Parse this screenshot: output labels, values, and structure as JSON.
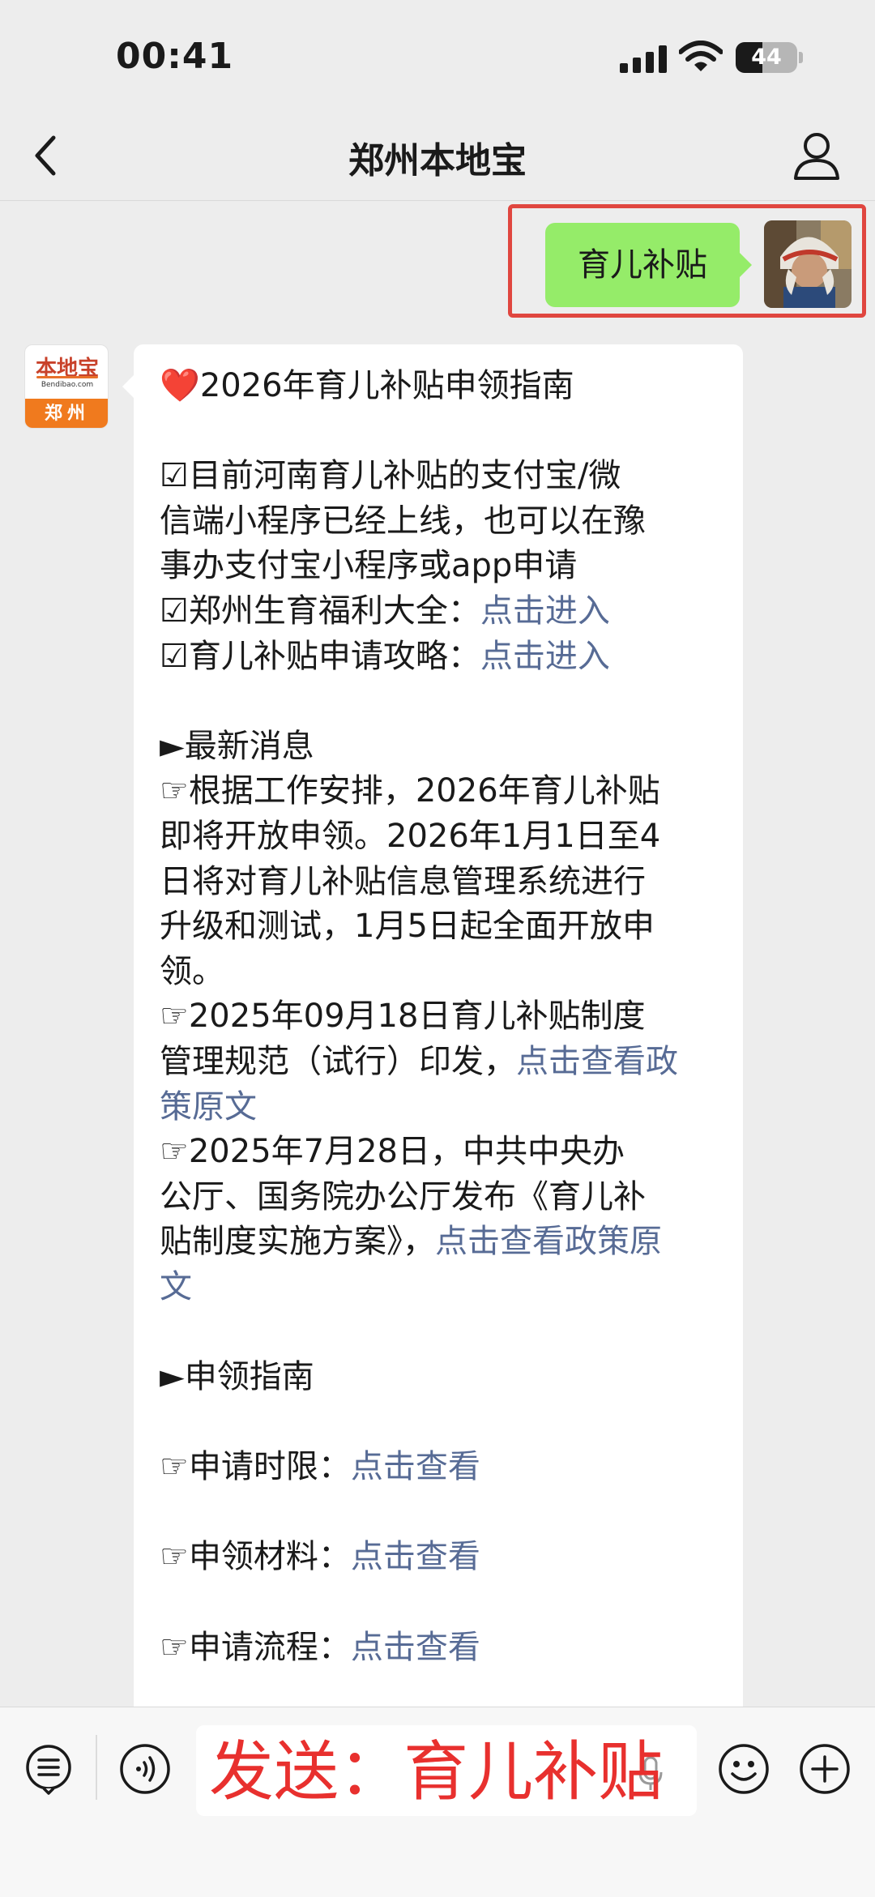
{
  "status_bar": {
    "time": "00:41",
    "battery": "44",
    "battery_level": 0.44
  },
  "nav": {
    "title": "郑州本地宝"
  },
  "outgoing_message": {
    "text": "育儿补贴"
  },
  "bot_avatar": {
    "logo_text": "本地宝",
    "logo_domain": "Bendibao.com",
    "city": "郑州"
  },
  "incoming_message": {
    "lines": [
      {
        "mark": "❤️",
        "text": "2026年育儿补贴申领指南",
        "link": ""
      },
      {
        "mark": "",
        "text": "",
        "link": ""
      },
      {
        "mark": "☑",
        "text": "目前河南育儿补贴的支付宝/微",
        "link": ""
      },
      {
        "mark": "",
        "text": "信端小程序已经上线，也可以在豫",
        "link": ""
      },
      {
        "mark": "",
        "text": "事办支付宝小程序或app申请",
        "link": ""
      },
      {
        "mark": "☑",
        "text": "郑州生育福利大全：",
        "link": "点击进入"
      },
      {
        "mark": "☑",
        "text": "育儿补贴申请攻略：",
        "link": "点击进入"
      },
      {
        "mark": "",
        "text": "",
        "link": ""
      },
      {
        "mark": "►",
        "text": "最新消息",
        "link": ""
      },
      {
        "mark": "☞",
        "text": "根据工作安排，2026年育儿补贴",
        "link": ""
      },
      {
        "mark": "",
        "text": "即将开放申领。2026年1月1日至4",
        "link": ""
      },
      {
        "mark": "",
        "text": "日将对育儿补贴信息管理系统进行",
        "link": ""
      },
      {
        "mark": "",
        "text": "升级和测试，1月5日起全面开放申",
        "link": ""
      },
      {
        "mark": "",
        "text": "领。",
        "link": ""
      },
      {
        "mark": "☞",
        "text": "2025年09月18日育儿补贴制度",
        "link": ""
      },
      {
        "mark": "",
        "text": "管理规范（试行）印发，",
        "link": "点击查看政"
      },
      {
        "mark": "",
        "text": "",
        "link": "策原文"
      },
      {
        "mark": "☞",
        "text": "2025年7月28日，中共中央办",
        "link": ""
      },
      {
        "mark": "",
        "text": "公厅、国务院办公厅发布《育儿补",
        "link": ""
      },
      {
        "mark": "",
        "text": "贴制度实施方案》，",
        "link": "点击查看政策原"
      },
      {
        "mark": "",
        "text": "",
        "link": "文"
      },
      {
        "mark": "",
        "text": "",
        "link": ""
      },
      {
        "mark": "►",
        "text": "申领指南",
        "link": ""
      },
      {
        "mark": "",
        "text": "",
        "link": ""
      },
      {
        "mark": "☞",
        "text": "申请时限：",
        "link": "点击查看"
      },
      {
        "mark": "",
        "text": "",
        "link": ""
      },
      {
        "mark": "☞",
        "text": "申领材料：",
        "link": "点击查看"
      },
      {
        "mark": "",
        "text": "",
        "link": ""
      },
      {
        "mark": "☞",
        "text": "申请流程：",
        "link": "点击查看"
      }
    ]
  },
  "input_bar": {
    "overlay_text": "发送：育儿补贴"
  },
  "icons": {
    "back": "chevron-left-icon",
    "profile": "person-icon",
    "menu": "menu-list-icon",
    "voice": "voice-icon",
    "mic": "microphone-icon",
    "emoji": "emoji-icon",
    "plus": "plus-icon"
  },
  "colors": {
    "outgoing_bubble": "#95ec69",
    "link": "#576b95",
    "highlight": "#e0463f",
    "overlay_text": "#e8302e",
    "brand_orange": "#f07a1e"
  }
}
